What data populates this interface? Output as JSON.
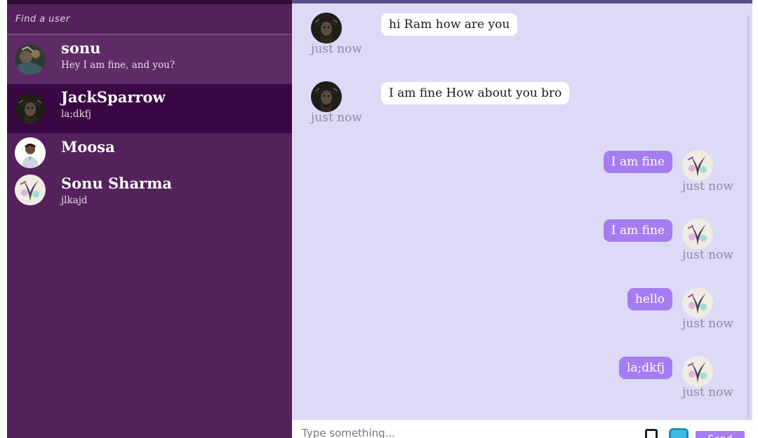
{
  "sidebar": {
    "search": {
      "placeholder": "Find a user"
    },
    "users": [
      {
        "name": "sonu",
        "last_message": "Hey I am fine, and you?",
        "avatar": "artwork-avatar"
      },
      {
        "name": "JackSparrow",
        "last_message": "la;dkfj",
        "avatar": "pirate-avatar"
      },
      {
        "name": "Moosa",
        "last_message": "",
        "avatar": "person-photo-avatar"
      },
      {
        "name": "Sonu Sharma",
        "last_message": "jlkajd",
        "avatar": "abstract-avatar"
      }
    ]
  },
  "chat": {
    "messages": [
      {
        "direction": "incoming",
        "text": "hi Ram how are you",
        "time": "just now"
      },
      {
        "direction": "incoming",
        "text": "I am fine How about you bro",
        "time": "just now"
      },
      {
        "direction": "outgoing",
        "text": "I am fine",
        "time": "just now"
      },
      {
        "direction": "outgoing",
        "text": "I am fine",
        "time": "just now"
      },
      {
        "direction": "outgoing",
        "text": "hello",
        "time": "just now"
      },
      {
        "direction": "outgoing",
        "text": "la;dkfj",
        "time": "just now"
      }
    ],
    "composer": {
      "placeholder": "Type something...",
      "send_label": "Send"
    }
  },
  "colors": {
    "sidebar_bg": "#54215c",
    "active_user_bg": "#3a0643",
    "chat_bg": "#dcdaf6",
    "outgoing_bubble": "#a67df0",
    "incoming_bubble": "#ffffff"
  }
}
